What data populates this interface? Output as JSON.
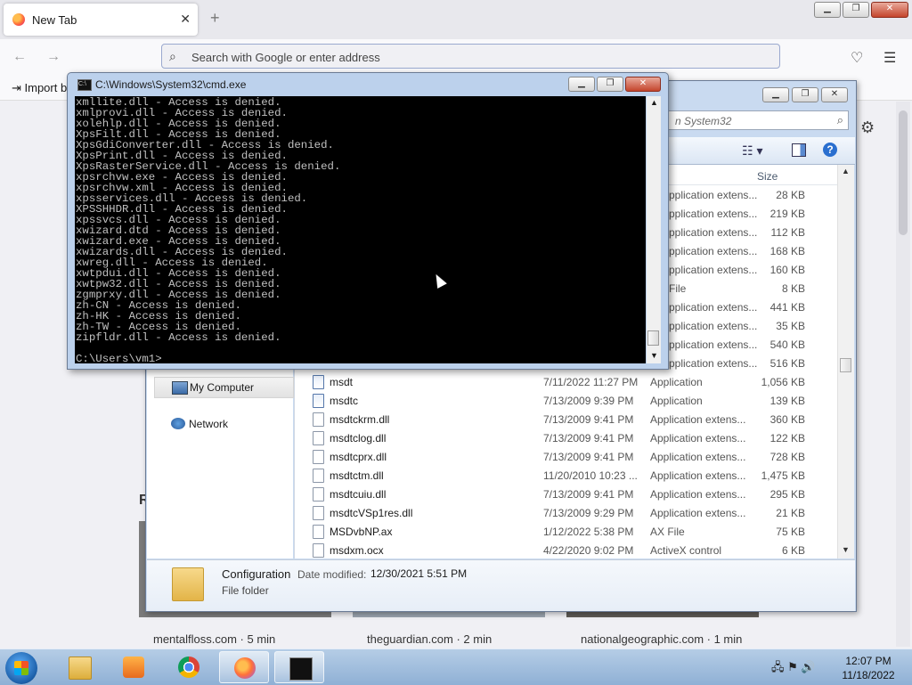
{
  "firefox": {
    "tab_title": "New Tab",
    "tab_close": "✕",
    "new_tab": "+",
    "url_placeholder": "Search with Google or enter address",
    "import_label": "Import b",
    "recent_heading": "R",
    "tiles": [
      "mentalfloss.com · 5 min",
      "theguardian.com · 2 min",
      "nationalgeographic.com · 1 min"
    ]
  },
  "explorer": {
    "search_placeholder": "n System32",
    "size_header": "Size",
    "nav": [
      {
        "label": "My Computer"
      },
      {
        "label": "Network"
      }
    ],
    "upper_rows": [
      {
        "type": "pplication extens...",
        "size": "28 KB"
      },
      {
        "type": "pplication extens...",
        "size": "219 KB"
      },
      {
        "type": "pplication extens...",
        "size": "112 KB"
      },
      {
        "type": "pplication extens...",
        "size": "168 KB"
      },
      {
        "type": "pplication extens...",
        "size": "160 KB"
      },
      {
        "type": "File",
        "size": "8 KB"
      },
      {
        "type": "pplication extens...",
        "size": "441 KB"
      },
      {
        "type": "pplication extens...",
        "size": "35 KB"
      },
      {
        "type": "pplication extens...",
        "size": "540 KB"
      },
      {
        "type": "pplication extens...",
        "size": "516 KB"
      }
    ],
    "rows": [
      {
        "name": "msdt",
        "date": "7/11/2022 11:27 PM",
        "type": "Application",
        "size": "1,056 KB",
        "icon": "app"
      },
      {
        "name": "msdtc",
        "date": "7/13/2009 9:39 PM",
        "type": "Application",
        "size": "139 KB",
        "icon": "app"
      },
      {
        "name": "msdtckrm.dll",
        "date": "7/13/2009 9:41 PM",
        "type": "Application extens...",
        "size": "360 KB",
        "icon": "dll"
      },
      {
        "name": "msdtclog.dll",
        "date": "7/13/2009 9:41 PM",
        "type": "Application extens...",
        "size": "122 KB",
        "icon": "dll"
      },
      {
        "name": "msdtcprx.dll",
        "date": "7/13/2009 9:41 PM",
        "type": "Application extens...",
        "size": "728 KB",
        "icon": "dll"
      },
      {
        "name": "msdtctm.dll",
        "date": "11/20/2010 10:23 ...",
        "type": "Application extens...",
        "size": "1,475 KB",
        "icon": "dll"
      },
      {
        "name": "msdtcuiu.dll",
        "date": "7/13/2009 9:41 PM",
        "type": "Application extens...",
        "size": "295 KB",
        "icon": "dll"
      },
      {
        "name": "msdtcVSp1res.dll",
        "date": "7/13/2009 9:29 PM",
        "type": "Application extens...",
        "size": "21 KB",
        "icon": "dll"
      },
      {
        "name": "MSDvbNP.ax",
        "date": "1/12/2022 5:38 PM",
        "type": "AX File",
        "size": "75 KB",
        "icon": "file"
      },
      {
        "name": "msdxm.ocx",
        "date": "4/22/2020 9:02 PM",
        "type": "ActiveX control",
        "size": "6 KB",
        "icon": "dll"
      }
    ],
    "details": {
      "name": "Configuration",
      "date_label": "Date modified:",
      "date_value": "12/30/2021 5:51 PM",
      "type": "File folder"
    }
  },
  "cmd": {
    "title": "C:\\Windows\\System32\\cmd.exe",
    "lines": [
      "xmllite.dll - Access is denied.",
      "xmlprovi.dll - Access is denied.",
      "xolehlp.dll - Access is denied.",
      "XpsFilt.dll - Access is denied.",
      "XpsGdiConverter.dll - Access is denied.",
      "XpsPrint.dll - Access is denied.",
      "XpsRasterService.dll - Access is denied.",
      "xpsrchvw.exe - Access is denied.",
      "xpsrchvw.xml - Access is denied.",
      "xpsservices.dll - Access is denied.",
      "XPSSHHDR.dll - Access is denied.",
      "xpssvcs.dll - Access is denied.",
      "xwizard.dtd - Access is denied.",
      "xwizard.exe - Access is denied.",
      "xwizards.dll - Access is denied.",
      "xwreg.dll - Access is denied.",
      "xwtpdui.dll - Access is denied.",
      "xwtpw32.dll - Access is denied.",
      "zgmprxy.dll - Access is denied.",
      "zh-CN - Access is denied.",
      "zh-HK - Access is denied.",
      "zh-TW - Access is denied.",
      "zipfldr.dll - Access is denied.",
      "",
      "C:\\Users\\vm1>"
    ]
  },
  "taskbar": {
    "time": "12:07 PM",
    "date": "11/18/2022"
  }
}
